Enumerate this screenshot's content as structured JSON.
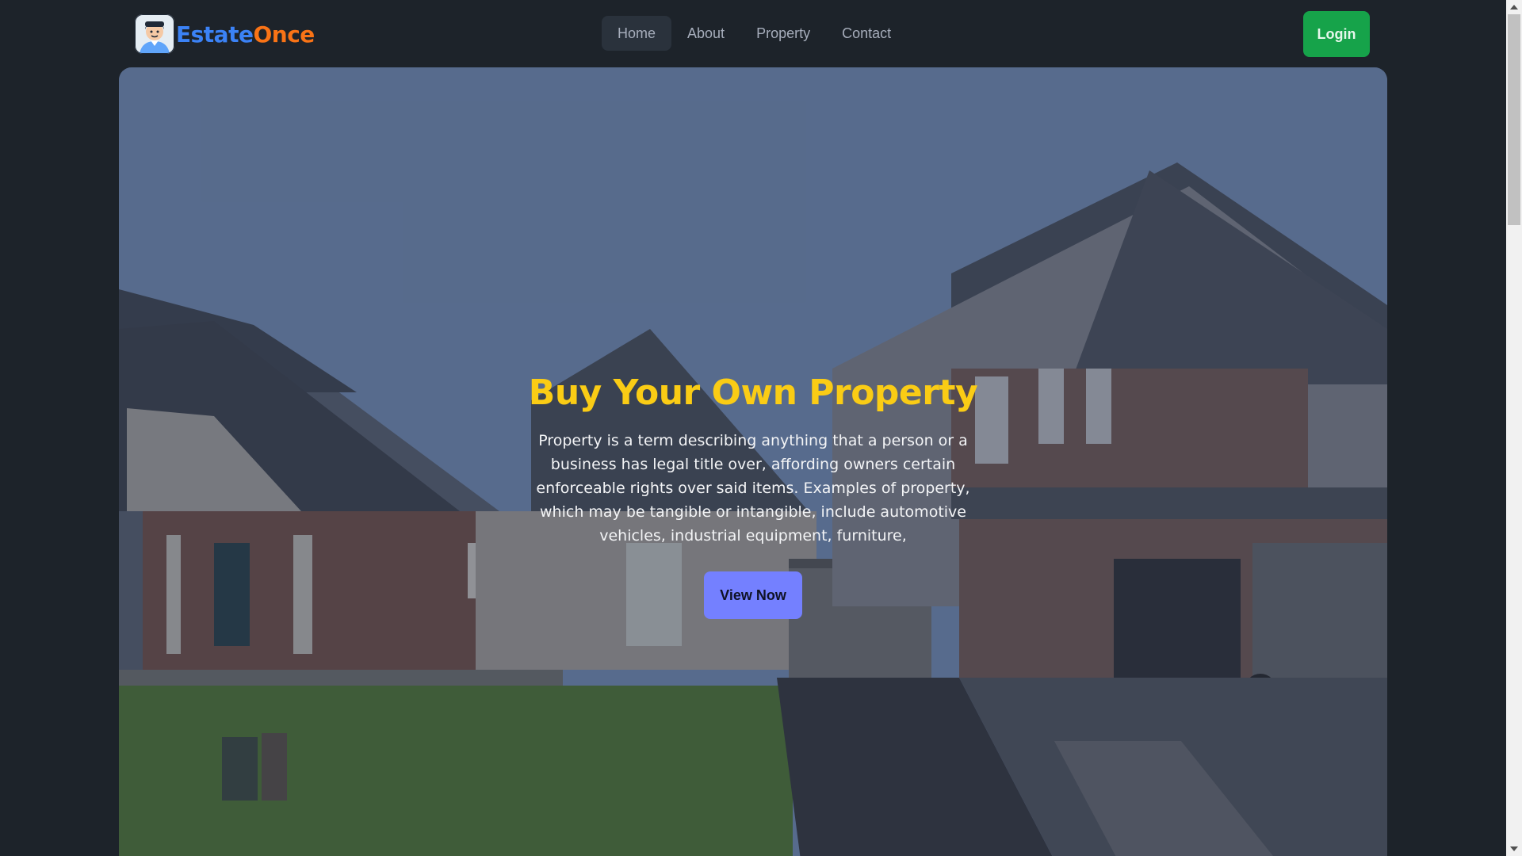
{
  "brand": {
    "part1": "Estate",
    "part2": "Once",
    "avatar_icon": "avatar-icon"
  },
  "nav": {
    "items": [
      {
        "label": "Home",
        "active": true
      },
      {
        "label": "About",
        "active": false
      },
      {
        "label": "Property",
        "active": false
      },
      {
        "label": "Contact",
        "active": false
      }
    ],
    "login_label": "Login"
  },
  "hero": {
    "title": "Buy Your Own Property",
    "description": "Property is a term describing anything that a person or a business has legal title over, affording owners certain enforceable rights over said items. Examples of property, which may be tangible or intangible, include automotive vehicles, industrial equipment, furniture,",
    "cta_label": "View Now"
  },
  "colors": {
    "background": "#1d232a",
    "brand_blue": "#3b82f6",
    "brand_orange": "#f97316",
    "login_green": "#16a34a",
    "hero_title": "#facc15",
    "cta": "#7480ff"
  }
}
